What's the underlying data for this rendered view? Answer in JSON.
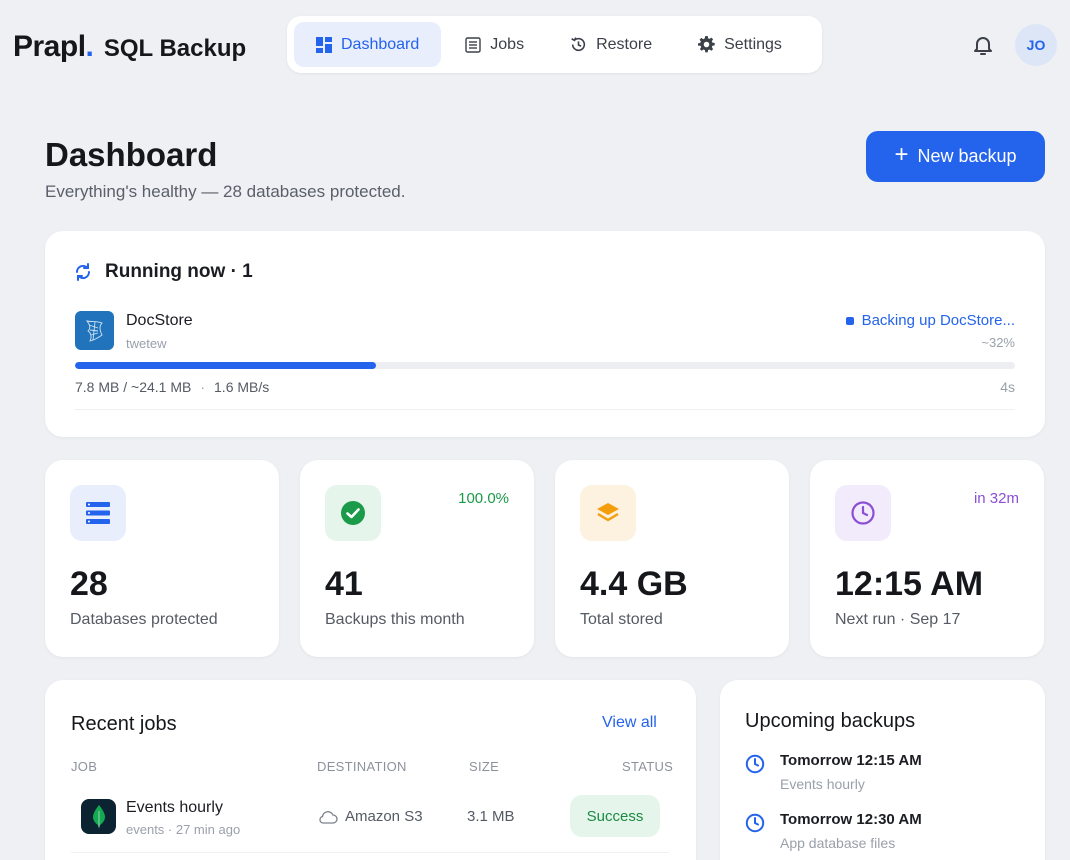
{
  "brand": {
    "logo": "Prapl",
    "dot": ".",
    "product": "SQL Backup"
  },
  "nav": {
    "items": [
      {
        "label": "Dashboard",
        "icon": "dashboard-icon",
        "active": true
      },
      {
        "label": "Jobs",
        "icon": "jobs-list-icon",
        "active": false
      },
      {
        "label": "Restore",
        "icon": "restore-icon",
        "active": false
      },
      {
        "label": "Settings",
        "icon": "gear-icon",
        "active": false
      }
    ]
  },
  "user": {
    "initials": "JO"
  },
  "header": {
    "title": "Dashboard",
    "subtitle": "Everything's healthy — 28 databases protected.",
    "new_backup_label": "New backup",
    "new_backup_icon": "+"
  },
  "running": {
    "title": "Running now · 1",
    "job": {
      "name": "DocStore",
      "sub": "twetew",
      "status": "Backing up DocStore...",
      "percent_label": "~32%",
      "progress": 0.32,
      "transferred": "7.8 MB / ~24.1 MB",
      "separator": "·",
      "rate": "1.6 MB/s",
      "elapsed": "4s"
    }
  },
  "stats": [
    {
      "value": "28",
      "label": "Databases protected",
      "badge": "",
      "icon": "database-list-icon",
      "color": "#2463eb",
      "bg": "#e8eefc"
    },
    {
      "value": "41",
      "label": "Backups this month",
      "badge": "100.0%",
      "icon": "check-circle-icon",
      "color": "#1b9a4a",
      "bg": "#e6f5ec"
    },
    {
      "value": "4.4 GB",
      "label": "Total stored",
      "badge": "",
      "icon": "layers-icon",
      "color": "#f59e0b",
      "bg": "#fdf1df"
    },
    {
      "value": "12:15 AM",
      "label": "Next run · Sep 17",
      "badge": "in 32m",
      "icon": "clock-icon",
      "color": "#8b4fd6",
      "bg": "#f1ebfb"
    }
  ],
  "recent_jobs": {
    "title": "Recent jobs",
    "view_all": "View all",
    "columns": [
      "JOB",
      "DESTINATION",
      "SIZE",
      "STATUS"
    ],
    "rows": [
      {
        "name": "Events hourly",
        "sub": "events · 27 min ago",
        "destination": "Amazon S3",
        "size": "3.1 MB",
        "status": "Success"
      }
    ]
  },
  "upcoming": {
    "title": "Upcoming backups",
    "items": [
      {
        "time": "Tomorrow 12:15 AM",
        "name": "Events hourly"
      },
      {
        "time": "Tomorrow 12:30 AM",
        "name": "App database files"
      }
    ]
  },
  "colors": {
    "accent": "#2463eb",
    "success": "#1b8a42",
    "background": "#eef0f4"
  }
}
